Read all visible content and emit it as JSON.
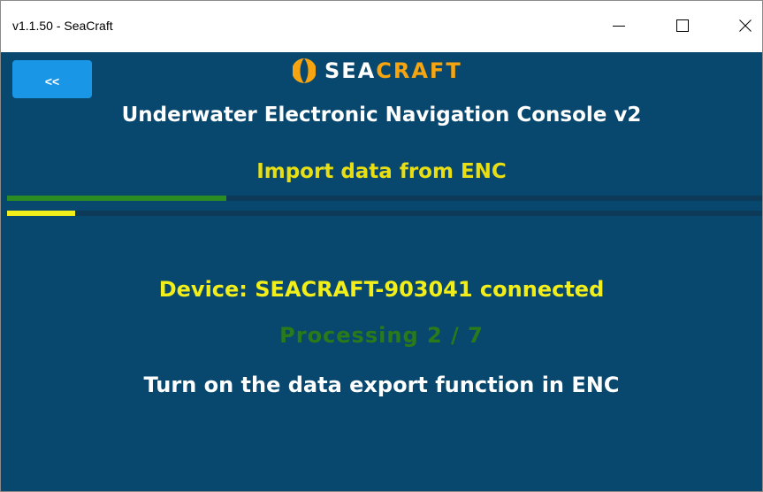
{
  "window": {
    "title": "v1.1.50 - SeaCraft",
    "controls": {
      "minimize": "minimize-icon",
      "maximize": "maximize-icon",
      "close": "close-icon"
    }
  },
  "header": {
    "back_label": "<<",
    "logo_text_a": "SEA",
    "logo_text_b": "CRAFT",
    "app_title": "Underwater Electronic Navigation Console v2",
    "step_title": "Import data from ENC"
  },
  "progress": {
    "overall_fraction": 0.29,
    "step_fraction": 0.09
  },
  "status": {
    "device": "Device: SEACRAFT-903041 connected",
    "processing": "Processing 2 / 7",
    "instruction": "Turn on the data export function in ENC"
  },
  "colors": {
    "background": "#09486e",
    "accent_yellow": "#f2ee1a",
    "accent_green": "#2c8c24",
    "button_blue": "#1a96e6",
    "logo_orange": "#f6a511"
  }
}
